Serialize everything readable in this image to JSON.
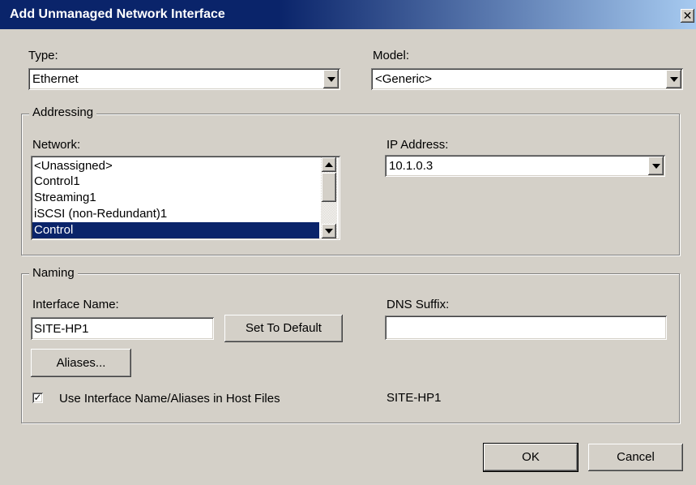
{
  "window": {
    "title": "Add Unmanaged Network Interface",
    "close_glyph": "✕"
  },
  "type": {
    "label": "Type:",
    "value": "Ethernet"
  },
  "model": {
    "label": "Model:",
    "value": "<Generic>"
  },
  "addressing": {
    "title": "Addressing",
    "network_label": "Network:",
    "network_items": [
      {
        "label": "<Unassigned>",
        "selected": false
      },
      {
        "label": "Control1",
        "selected": false
      },
      {
        "label": "Streaming1",
        "selected": false
      },
      {
        "label": "iSCSI (non-Redundant)1",
        "selected": false
      },
      {
        "label": "Control",
        "selected": true
      }
    ],
    "ip_label": "IP Address:",
    "ip_value": "10.1.0.3"
  },
  "naming": {
    "title": "Naming",
    "interface_name_label": "Interface Name:",
    "interface_name_value": "SITE-HP1",
    "set_default_label": "Set To Default",
    "dns_suffix_label": "DNS Suffix:",
    "dns_suffix_value": "",
    "aliases_label": "Aliases...",
    "use_in_host_files_label": "Use Interface Name/Aliases in Host Files",
    "use_in_host_files_checked": true,
    "host_name_preview": "SITE-HP1"
  },
  "buttons": {
    "ok_label": "OK",
    "cancel_label": "Cancel"
  },
  "icons": {
    "close": "close-icon",
    "dropdown": "chevron-down-icon",
    "scroll_up": "scroll-up-icon",
    "scroll_down": "scroll-down-icon",
    "check": "checkmark-icon"
  },
  "colors": {
    "title_bar": "#0a246a",
    "title_gradient_end": "#a6caf0",
    "dialog_bg": "#d4d0c8",
    "selection": "#0a246a"
  }
}
